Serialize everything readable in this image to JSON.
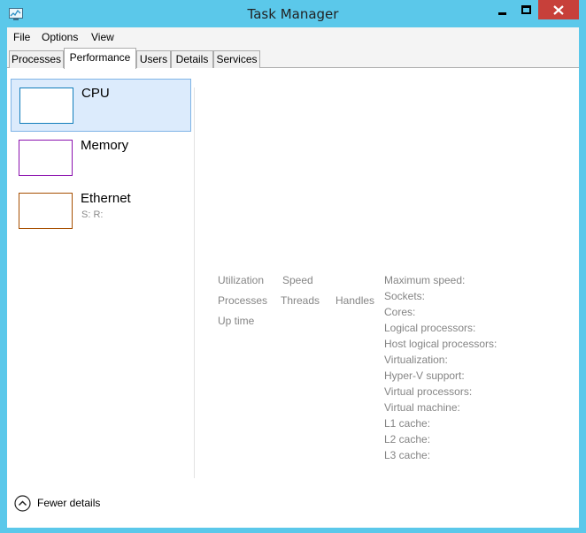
{
  "window": {
    "title": "Task Manager"
  },
  "menu": [
    "File",
    "Options",
    "View"
  ],
  "tabs": [
    {
      "label": "Processes",
      "active": false
    },
    {
      "label": "Performance",
      "active": true
    },
    {
      "label": "Users",
      "active": false
    },
    {
      "label": "Details",
      "active": false
    },
    {
      "label": "Services",
      "active": false
    }
  ],
  "sidebar": {
    "items": [
      {
        "name": "CPU",
        "sub": "",
        "color": "#117dbb",
        "selected": true
      },
      {
        "name": "Memory",
        "sub": "",
        "color": "#8b12ae",
        "selected": false
      },
      {
        "name": "Ethernet",
        "sub": "S:  R:",
        "color": "#a74f01",
        "selected": false
      }
    ]
  },
  "stats": {
    "utilization": "Utilization",
    "speed": "Speed",
    "processes": "Processes",
    "threads": "Threads",
    "handles": "Handles",
    "up_time": "Up time"
  },
  "details": [
    "Maximum speed:",
    "Sockets:",
    "Cores:",
    "Logical processors:",
    "Host logical processors:",
    "Virtualization:",
    "Hyper-V support:",
    "Virtual processors:",
    "Virtual machine:",
    "L1 cache:",
    "L2 cache:",
    "L3 cache:"
  ],
  "footer": {
    "fewer_details": "Fewer details"
  },
  "colors": {
    "titlebar": "#5bc8ea",
    "close_button": "#c7403a",
    "selection": "#dcebfc"
  },
  "icons": [
    "task-manager-icon",
    "minimize-icon",
    "maximize-icon",
    "close-icon",
    "chevron-up-icon"
  ]
}
